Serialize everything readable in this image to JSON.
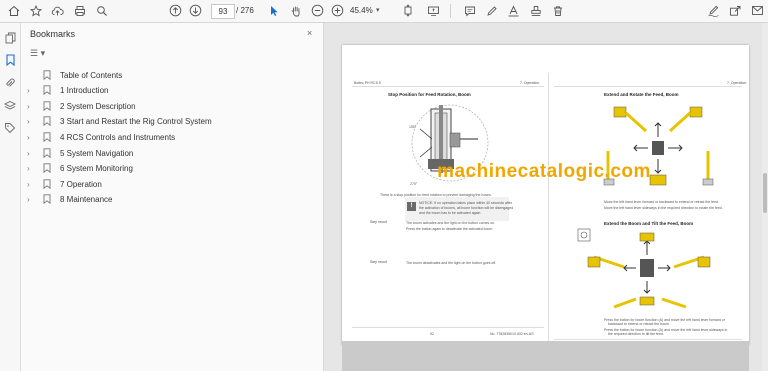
{
  "toolbar": {
    "page_current": "93",
    "page_total": "/ 276",
    "zoom": "45.4%",
    "zoom_arrow": "▾"
  },
  "bookmarks": {
    "title": "Bookmarks",
    "close_label": "×",
    "options_label": "☰ ▾",
    "items": [
      {
        "label": "Table of Contents",
        "expandable": false
      },
      {
        "label": "1 Introduction",
        "expandable": true
      },
      {
        "label": "2 System Description",
        "expandable": true
      },
      {
        "label": "3 Start and Restart the Rig Control System",
        "expandable": true
      },
      {
        "label": "4 RCS Controls and Instruments",
        "expandable": true
      },
      {
        "label": "5 System Navigation",
        "expandable": true
      },
      {
        "label": "6 System Monitoring",
        "expandable": true
      },
      {
        "label": "7 Operation",
        "expandable": true
      },
      {
        "label": "8 Maintenance",
        "expandable": true
      }
    ]
  },
  "document": {
    "left_header_left": "Boltec PH RCS 5",
    "left_header_right": "7. Operation",
    "right_header_right": "7. Operation",
    "left_title": "Stop Position for Feed Rotation, Boom",
    "angle_top": "150°",
    "angle_bottom": "270°",
    "left_para": "There is a stop position for feed rotation to prevent damaging the hoses.",
    "step_label": "Step result",
    "left_step1": "The boom activates and the light on the button comes on.",
    "note_text1": "NOTICE: If no operation takes place within 40 seconds after",
    "note_text2": "the activation of booms, all boom function will be disengaged",
    "note_text3": "and the boom has to be activated again.",
    "left_step2": "Press the button again to deactivate the activated boom",
    "left_step3": "The boom deactivates and the light on the button goes off.",
    "right_title1": "Extend and Rotate the Feed, Boom",
    "right_bullet1": "Move the left hand lever forward or backward to extend or retract the feed.",
    "right_bullet2": "Move the left hand lever sideways in the required direction to rotate the feed.",
    "right_title2": "Extend the Boom and Tilt the Feed, Boom",
    "right_bullet3": "Press the button for boom function (A) and move the left hand lever forward or",
    "right_bullet3b": "backward to extend or retract the boom.",
    "right_bullet4": "Press the button for boom function (A) and move the left hand lever sideways in",
    "right_bullet4b": "the required direction to tilt the feed.",
    "left_footer_page": "92",
    "left_footer_doc": "No. 7782835010.002 en-US",
    "right_footer_page": "93",
    "right_footer_doc": "No. 7782835010.002 en-US",
    "watermark": "machinecatalogic.com"
  },
  "colors": {
    "watermark": "#f0a800",
    "machine_yellow": "#e8c400",
    "bookmark_accent": "#1a6fd1"
  }
}
